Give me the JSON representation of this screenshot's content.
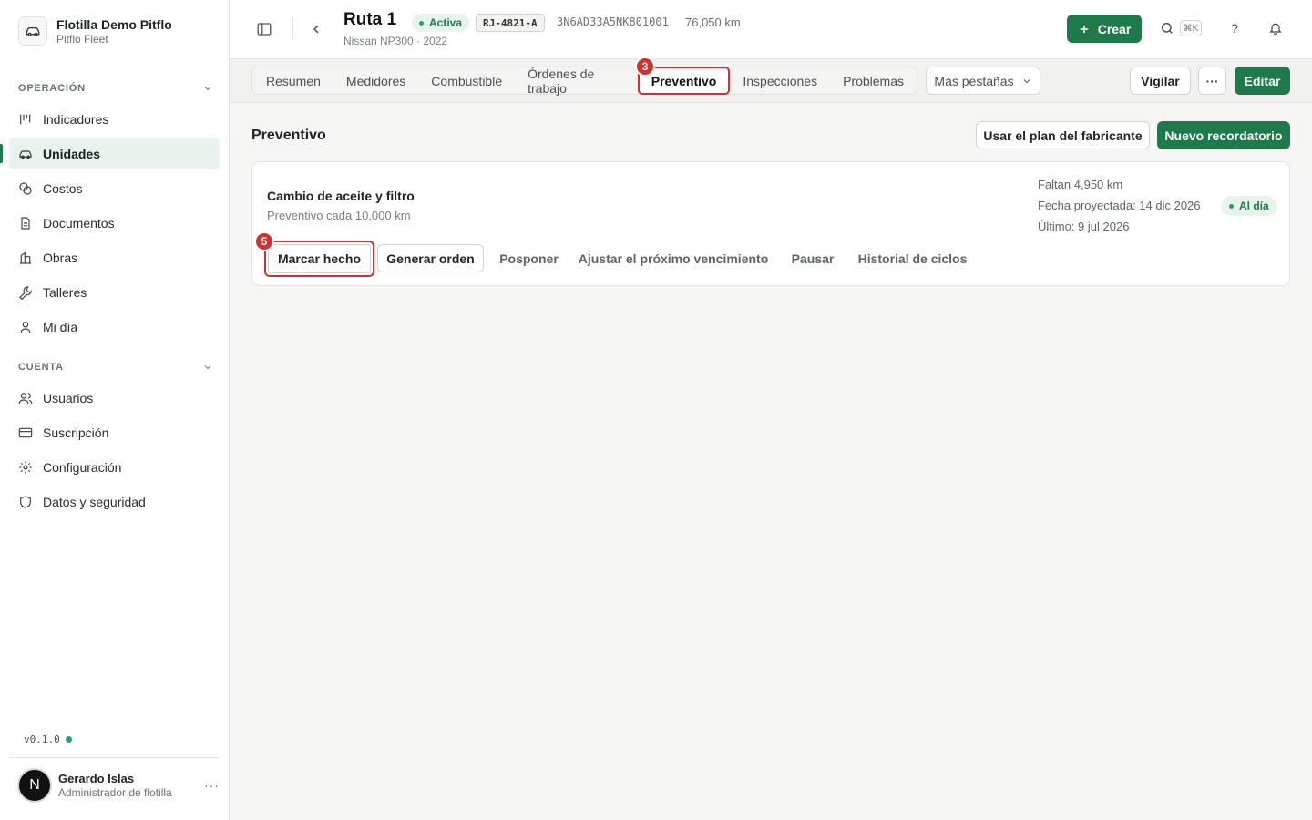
{
  "org": {
    "name": "Flotilla Demo Pitflo",
    "sub": "Pitflo Fleet"
  },
  "sidebar": {
    "section_ops": "OPERACIÓN",
    "ops_items": [
      {
        "label": "Indicadores",
        "icon": "chart-icon"
      },
      {
        "label": "Unidades",
        "icon": "car-icon"
      },
      {
        "label": "Costos",
        "icon": "coins-icon"
      },
      {
        "label": "Documentos",
        "icon": "document-icon"
      },
      {
        "label": "Obras",
        "icon": "building-icon"
      },
      {
        "label": "Talleres",
        "icon": "wrench-icon"
      },
      {
        "label": "Mi día",
        "icon": "person-icon"
      }
    ],
    "section_account": "CUENTA",
    "account_items": [
      {
        "label": "Usuarios",
        "icon": "users-icon"
      },
      {
        "label": "Suscripción",
        "icon": "card-icon"
      },
      {
        "label": "Configuración",
        "icon": "gear-icon"
      },
      {
        "label": "Datos y seguridad",
        "icon": "shield-icon"
      }
    ],
    "active": "Unidades",
    "version": "v0.1.0",
    "user": {
      "initial": "N",
      "name": "Gerardo Islas",
      "role": "Administrador de flotilla",
      "more": "···"
    }
  },
  "header": {
    "title": "Ruta 1",
    "status": "Activa",
    "plate": "RJ-4821-A",
    "vin": "3N6AD33A5NK801001",
    "km": "76,050 km",
    "subtitle": "Nissan NP300 · 2022",
    "create_label": "Crear",
    "shortcut": "⌘K",
    "help": "?"
  },
  "tabs": {
    "items": [
      "Resumen",
      "Medidores",
      "Combustible",
      "Órdenes de trabajo",
      "Preventivo",
      "Inspecciones",
      "Problemas"
    ],
    "active": "Preventivo",
    "more": "Más pestañas",
    "watch": "Vigilar",
    "more_actions": "···",
    "edit": "Editar",
    "step_tab": "3"
  },
  "main": {
    "heading": "Preventivo",
    "use_plan": "Usar el plan del fabricante",
    "new_reminder": "Nuevo recordatorio",
    "card": {
      "title": "Cambio de aceite y filtro",
      "sub": "Preventivo cada 10,000 km",
      "remaining": "Faltan 4,950 km",
      "projected": "Fecha proyectada: 14 dic 2026",
      "last": "Último: 9 jul 2026",
      "status": "Al día",
      "actions": [
        "Marcar hecho",
        "Generar orden",
        "Posponer",
        "Ajustar el próximo vencimiento",
        "Pausar",
        "Historial de ciclos"
      ],
      "step_action": "5"
    }
  },
  "colors": {
    "accent": "#1e7a4a",
    "highlight": "#d0312d"
  }
}
